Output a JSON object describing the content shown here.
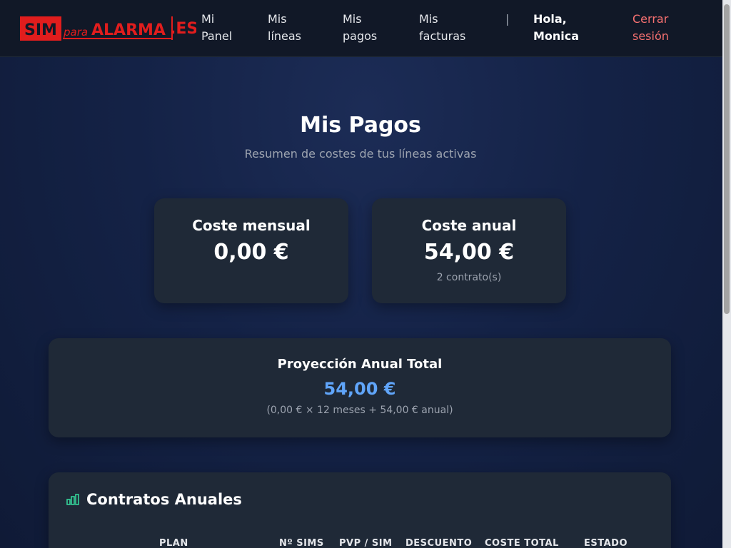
{
  "brand": {
    "logo_sim": "SIM",
    "logo_para": "para",
    "logo_alarma": "ALARMA",
    "logo_es": ".ES",
    "primary_color": "#e11d1d",
    "accent_color": "#60a5fa",
    "logout_color": "#f87171"
  },
  "nav": {
    "items": [
      {
        "line1": "Mi",
        "line2": "Panel"
      },
      {
        "line1": "Mis",
        "line2": "líneas"
      },
      {
        "line1": "Mis",
        "line2": "pagos"
      },
      {
        "line1": "Mis",
        "line2": "facturas"
      }
    ],
    "separator": "|",
    "greeting_line1": "Hola,",
    "greeting_line2": "Monica",
    "logout_line1": "Cerrar",
    "logout_line2": "sesión"
  },
  "page": {
    "title": "Mis Pagos",
    "subtitle": "Resumen de costes de tus líneas activas"
  },
  "stats": {
    "monthly": {
      "label": "Coste mensual",
      "value": "0,00 €"
    },
    "annual": {
      "label": "Coste anual",
      "value": "54,00 €",
      "note": "2 contrato(s)"
    }
  },
  "projection": {
    "label": "Proyección Anual Total",
    "value": "54,00 €",
    "formula": "(0,00 € × 12 meses + 54,00 € anual)"
  },
  "contracts": {
    "icon": "bar-chart-icon",
    "title": "Contratos Anuales",
    "columns": [
      "PLAN",
      "Nº SIMS",
      "PVP / SIM",
      "DESCUENTO",
      "COSTE TOTAL",
      "ESTADO"
    ]
  }
}
